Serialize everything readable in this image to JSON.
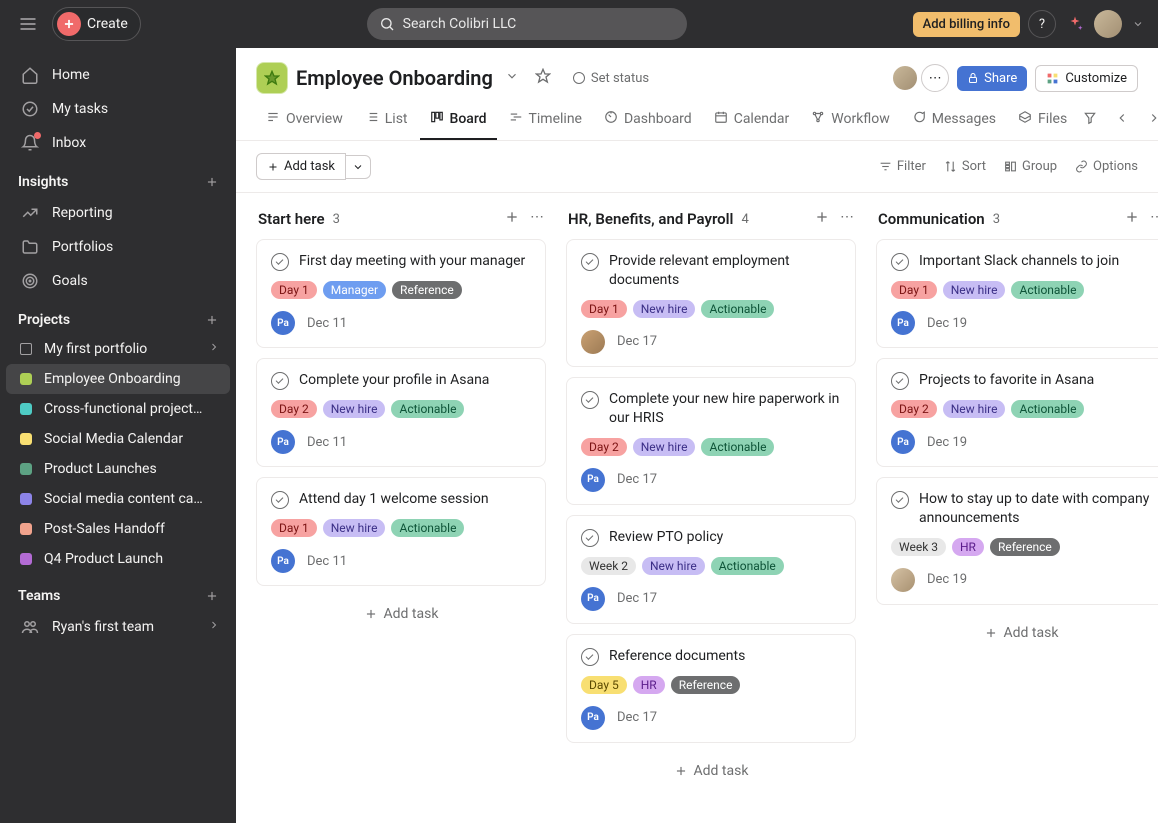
{
  "topbar": {
    "create_label": "Create",
    "search_placeholder": "Search Colibri LLC",
    "billing_label": "Add billing info",
    "help_label": "?"
  },
  "sidebar": {
    "nav": [
      {
        "label": "Home",
        "icon": "home"
      },
      {
        "label": "My tasks",
        "icon": "check-circle"
      },
      {
        "label": "Inbox",
        "icon": "bell",
        "dot": true
      }
    ],
    "insights_label": "Insights",
    "insights": [
      {
        "label": "Reporting",
        "icon": "chart"
      },
      {
        "label": "Portfolios",
        "icon": "folder"
      },
      {
        "label": "Goals",
        "icon": "target"
      }
    ],
    "projects_label": "Projects",
    "projects": [
      {
        "label": "My first portfolio",
        "portfolio": true,
        "chevron": true
      },
      {
        "label": "Employee Onboarding",
        "color": "#aecf55",
        "active": true
      },
      {
        "label": "Cross-functional project p...",
        "color": "#4ecbc4"
      },
      {
        "label": "Social Media Calendar",
        "color": "#f8df72"
      },
      {
        "label": "Product Launches",
        "color": "#5da283"
      },
      {
        "label": "Social media content cale...",
        "color": "#8d84e8"
      },
      {
        "label": "Post-Sales Handoff",
        "color": "#f1a38d"
      },
      {
        "label": "Q4 Product Launch",
        "color": "#b36bd4"
      }
    ],
    "teams_label": "Teams",
    "teams": [
      {
        "label": "Ryan's first team",
        "icon": "people",
        "chevron": true
      }
    ]
  },
  "project": {
    "title": "Employee Onboarding",
    "status_label": "Set status",
    "share_label": "Share",
    "customize_label": "Customize",
    "tabs": [
      "Overview",
      "List",
      "Board",
      "Timeline",
      "Dashboard",
      "Calendar",
      "Workflow",
      "Messages",
      "Files"
    ],
    "active_tab": "Board"
  },
  "toolbar": {
    "add_task_label": "Add task",
    "filter_label": "Filter",
    "sort_label": "Sort",
    "group_label": "Group",
    "options_label": "Options"
  },
  "tag_palette": {
    "Day 1": {
      "bg": "#f7a2a1",
      "fg": "#7b1313"
    },
    "Day 2": {
      "bg": "#f7a2a1",
      "fg": "#7b1313"
    },
    "Day 5": {
      "bg": "#f8df72",
      "fg": "#5b4a00"
    },
    "Week 2": {
      "bg": "#e8e8e8",
      "fg": "#333"
    },
    "Week 3": {
      "bg": "#e8e8e8",
      "fg": "#333"
    },
    "Manager": {
      "bg": "#6e9df0",
      "fg": "#fff"
    },
    "New hire": {
      "bg": "#c7bdf4",
      "fg": "#3b2f87"
    },
    "Actionable": {
      "bg": "#8ed3b4",
      "fg": "#0e5438"
    },
    "Reference": {
      "bg": "#6d6e6f",
      "fg": "#fff"
    },
    "HR": {
      "bg": "#d5a8f0",
      "fg": "#5a1c8a"
    }
  },
  "avatars": {
    "Pa": {
      "type": "initials",
      "text": "Pa",
      "bg": "#4573d2"
    },
    "photo1": {
      "type": "photo",
      "bg": "linear-gradient(135deg,#caa173,#9c7a54)"
    },
    "photo2": {
      "type": "photo",
      "bg": "linear-gradient(135deg,#d5c2a5,#a89070)"
    }
  },
  "board": {
    "add_task_label": "Add task",
    "columns": [
      {
        "title": "Start here",
        "count": 3,
        "cards": [
          {
            "title": "First day meeting with your manager",
            "tags": [
              "Day 1",
              "Manager",
              "Reference"
            ],
            "avatar": "Pa",
            "date": "Dec 11"
          },
          {
            "title": "Complete your profile in Asana",
            "tags": [
              "Day 2",
              "New hire",
              "Actionable"
            ],
            "avatar": "Pa",
            "date": "Dec 11"
          },
          {
            "title": "Attend day 1 welcome session",
            "tags": [
              "Day 1",
              "New hire",
              "Actionable"
            ],
            "avatar": "Pa",
            "date": "Dec 11"
          }
        ]
      },
      {
        "title": "HR, Benefits, and Payroll",
        "count": 4,
        "cards": [
          {
            "title": "Provide relevant employment documents",
            "tags": [
              "Day 1",
              "New hire",
              "Actionable"
            ],
            "avatar": "photo1",
            "date": "Dec 17"
          },
          {
            "title": "Complete your new hire paperwork in our HRIS",
            "tags": [
              "Day 2",
              "New hire",
              "Actionable"
            ],
            "avatar": "Pa",
            "date": "Dec 17"
          },
          {
            "title": "Review PTO policy",
            "tags": [
              "Week 2",
              "New hire",
              "Actionable"
            ],
            "avatar": "Pa",
            "date": "Dec 17"
          },
          {
            "title": "Reference documents",
            "tags": [
              "Day 5",
              "HR",
              "Reference"
            ],
            "avatar": "Pa",
            "date": "Dec 17"
          }
        ]
      },
      {
        "title": "Communication",
        "count": 3,
        "cards": [
          {
            "title": "Important Slack channels to join",
            "tags": [
              "Day 1",
              "New hire",
              "Actionable"
            ],
            "avatar": "Pa",
            "date": "Dec 19"
          },
          {
            "title": "Projects to favorite in Asana",
            "tags": [
              "Day 2",
              "New hire",
              "Actionable"
            ],
            "avatar": "Pa",
            "date": "Dec 19"
          },
          {
            "title": "How to stay up to date with company announcements",
            "tags": [
              "Week 3",
              "HR",
              "Reference"
            ],
            "avatar": "photo2",
            "date": "Dec 19"
          }
        ]
      }
    ]
  }
}
